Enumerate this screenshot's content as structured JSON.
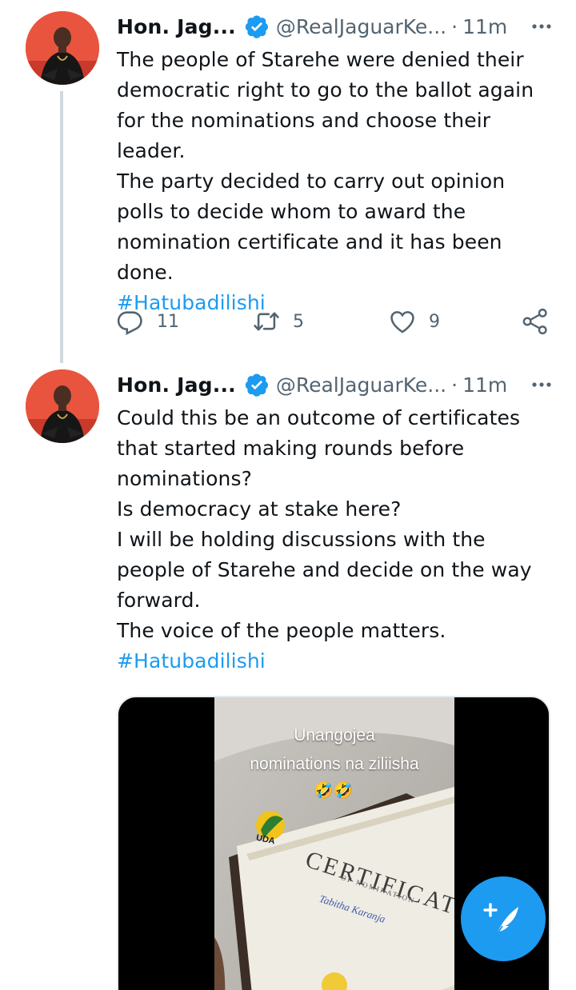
{
  "tweets": [
    {
      "author_name": "Hon. Jag...",
      "handle": "@RealJaguarKe...",
      "time": "11m",
      "separator": "·",
      "lines": [
        "The people of Starehe were denied their democratic right to go to the ballot again for the nominations and choose their leader.",
        "The party decided to carry out opinion polls to decide whom to award the nomination certificate and it has been done."
      ],
      "hashtag": "#Hatubadilishi",
      "replies": "11",
      "retweets": "5",
      "likes": "9"
    },
    {
      "author_name": "Hon. Jag...",
      "handle": "@RealJaguarKe...",
      "time": "11m",
      "separator": "·",
      "lines": [
        "Could this be an outcome of certificates that started making rounds before nominations?",
        "Is democracy at stake here?",
        "I will be holding discussions with the people of Starehe and decide on the way forward.",
        "The voice of the people matters."
      ],
      "hashtag": "#Hatubadilishi",
      "media": {
        "caption_line1": "Unangojea",
        "caption_line2": "nominations na ziliisha",
        "emoji": "🤣🤣",
        "certificate_title": "CERTIFICATE",
        "certificate_subtitle": "OF NOMINATION",
        "certificate_name": "Tabitha Karanja",
        "logo_text": "UDA"
      }
    }
  ],
  "icons": {
    "verified": "verified-badge-icon",
    "more": "more-icon",
    "reply": "reply-icon",
    "retweet": "retweet-icon",
    "like": "like-icon",
    "share": "share-icon",
    "compose": "compose-tweet-icon"
  },
  "colors": {
    "accent": "#1d9bf0",
    "secondary_text": "#536471",
    "primary_text": "#0f1419",
    "thread_line": "#cfd9de"
  }
}
